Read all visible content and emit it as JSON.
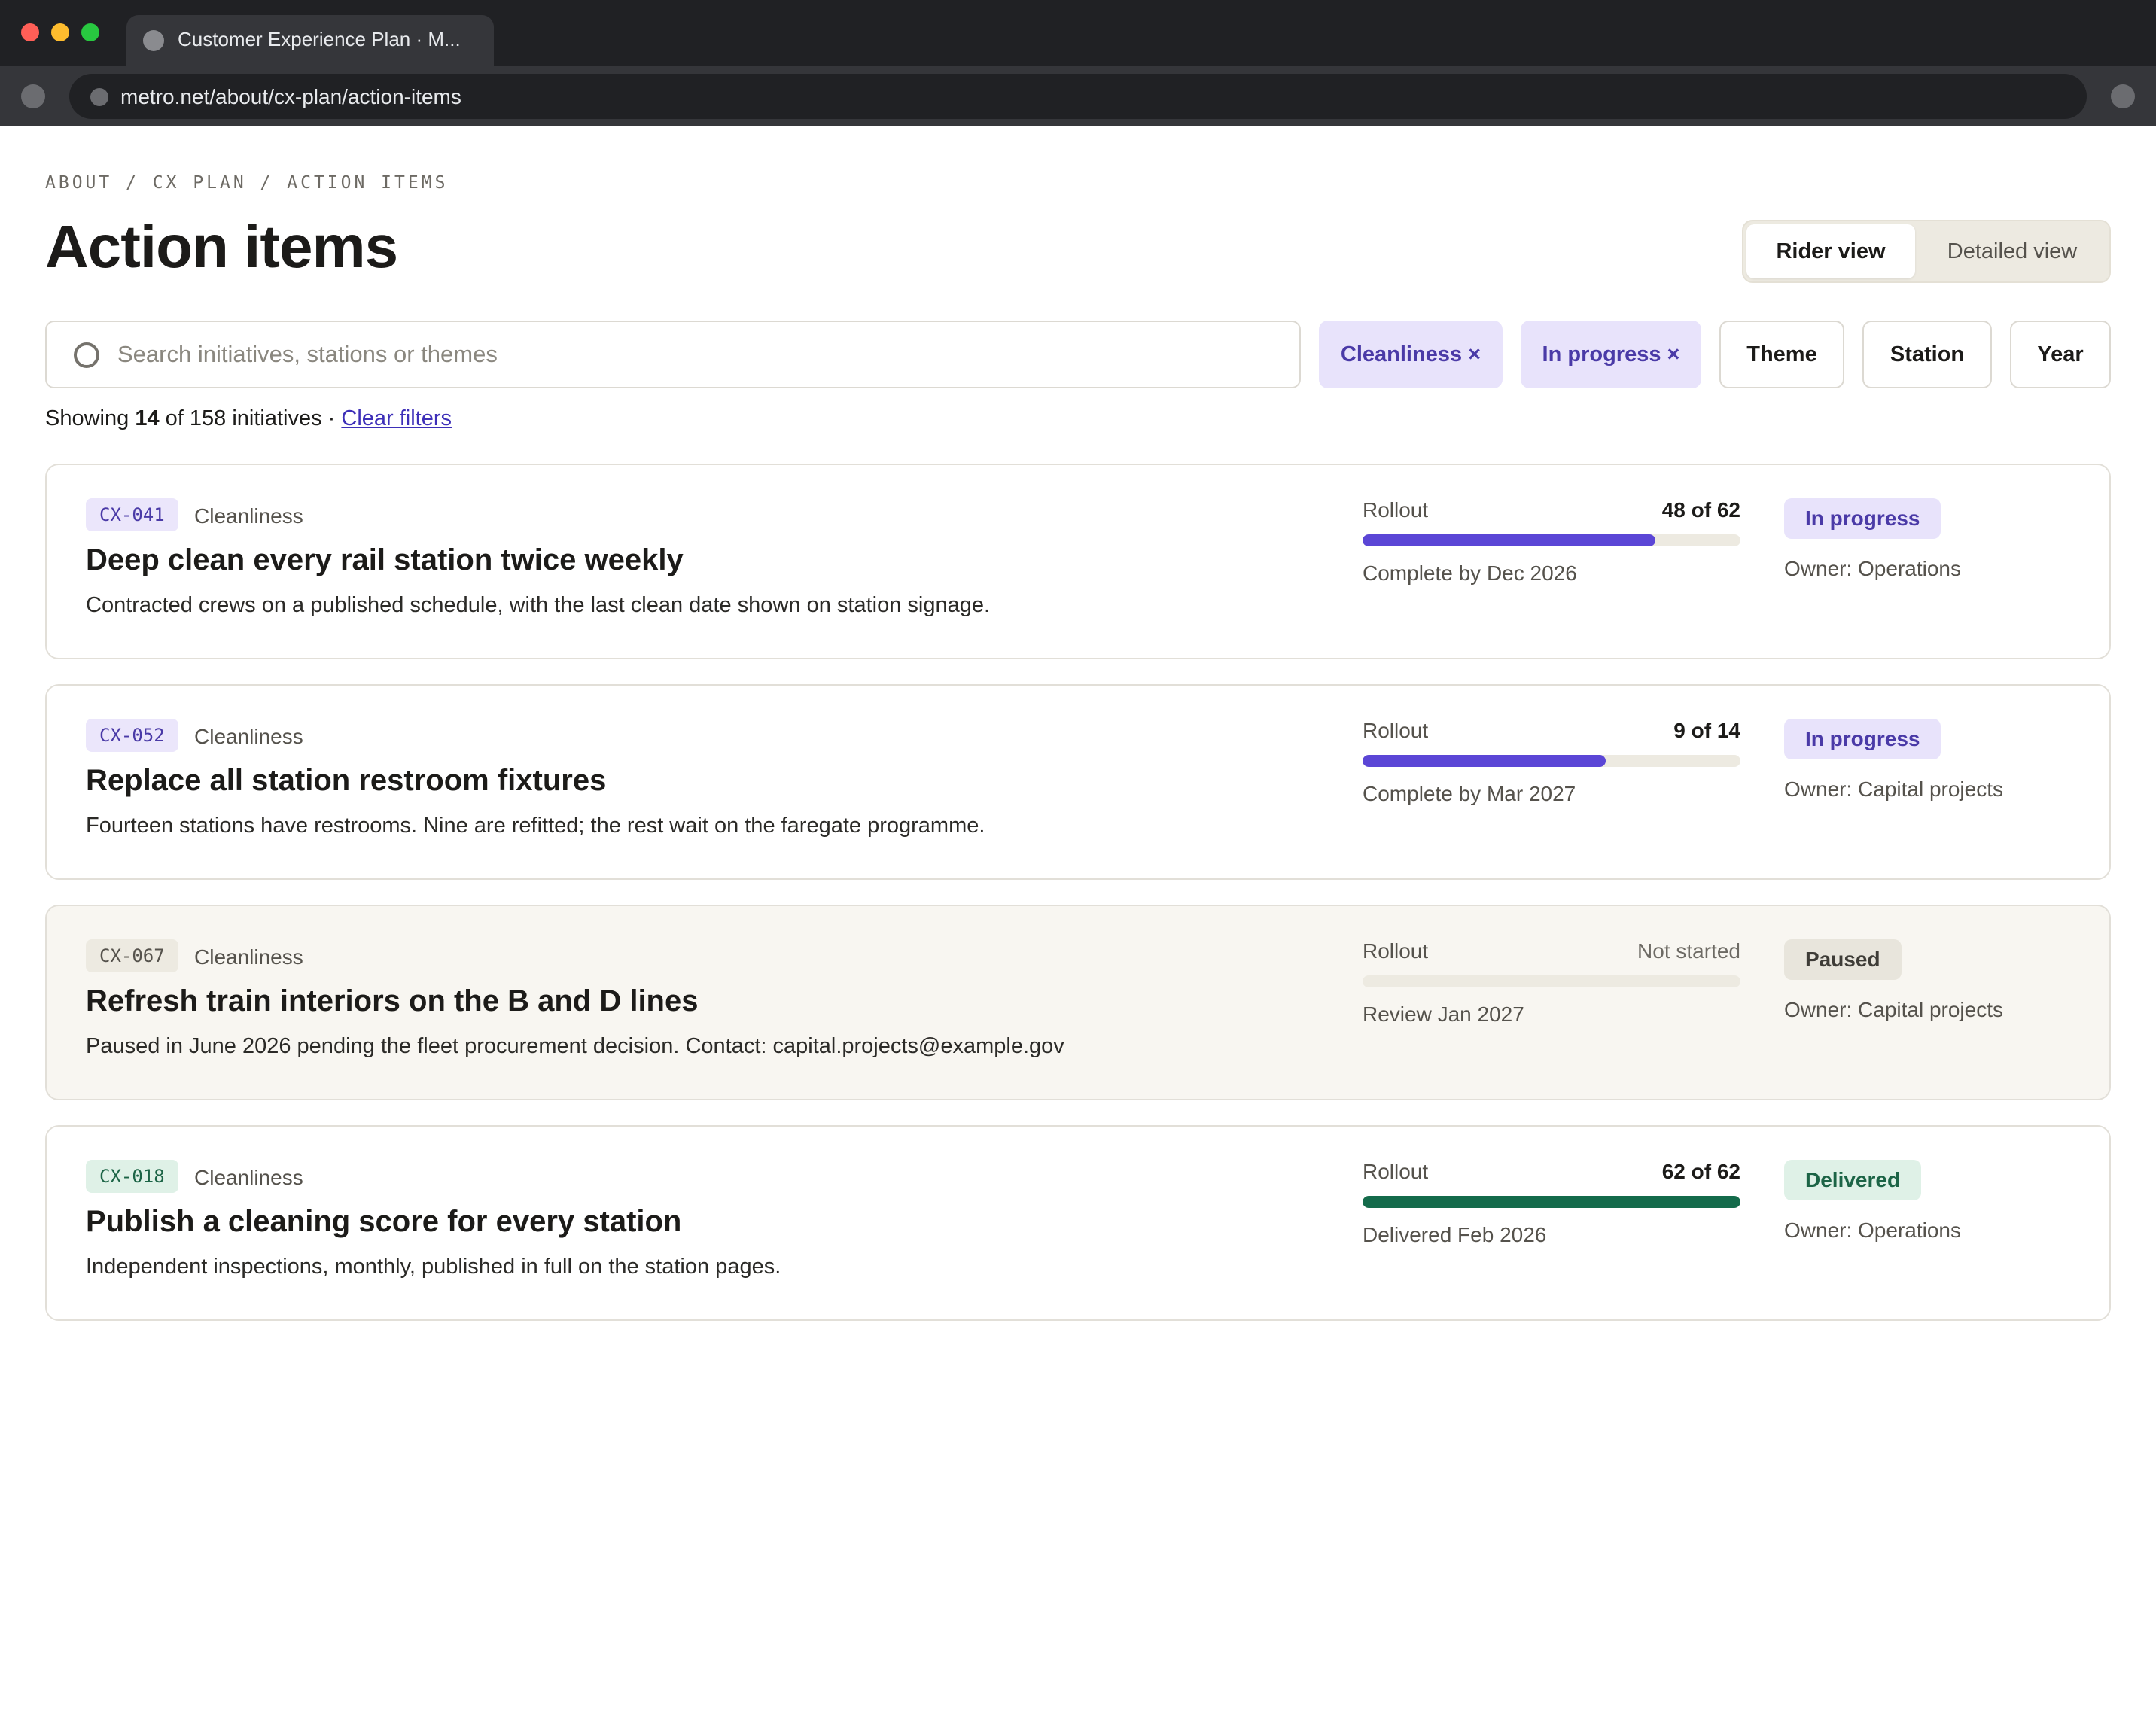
{
  "browser": {
    "tab_title": "Customer Experience Plan · M...",
    "url": "metro.net/about/cx-plan/action-items"
  },
  "breadcrumb": "ABOUT / CX PLAN / ACTION ITEMS",
  "page_title": "Action items",
  "view_toggle": {
    "active": "Rider view",
    "inactive": "Detailed view"
  },
  "search": {
    "placeholder": "Search initiatives, stations or themes",
    "value": ""
  },
  "filters": {
    "active_chips": [
      "Cleanliness ×",
      "In progress ×"
    ],
    "buttons": [
      "Theme",
      "Station",
      "Year"
    ]
  },
  "results": {
    "prefix": "Showing ",
    "shown": "14",
    "suffix": " of 158 initiatives · ",
    "clear_label": "Clear filters"
  },
  "rollout_label": "Rollout",
  "items": [
    {
      "code": "CX-041",
      "theme": "Cleanliness",
      "title": "Deep clean every rail station twice weekly",
      "description": "Contracted crews on a published schedule, with the last clean date shown on station signage.",
      "rollout_text": "48 of 62",
      "rollout_done": 48,
      "rollout_total": 62,
      "due": "Complete by Dec 2026",
      "status": "In progress",
      "owner": "Owner: Operations",
      "colors": {
        "accent": "#5b46d6",
        "status_bg": "#e8e3fb",
        "status_fg": "#4a3aa7"
      }
    },
    {
      "code": "CX-052",
      "theme": "Cleanliness",
      "title": "Replace all station restroom fixtures",
      "description": "Fourteen stations have restrooms. Nine are refitted; the rest wait on the faregate programme.",
      "rollout_text": "9 of 14",
      "rollout_done": 9,
      "rollout_total": 14,
      "due": "Complete by Mar 2027",
      "status": "In progress",
      "owner": "Owner: Capital projects",
      "colors": {
        "accent": "#5b46d6",
        "status_bg": "#e8e3fb",
        "status_fg": "#4a3aa7"
      }
    },
    {
      "code": "CX-067",
      "theme": "Cleanliness",
      "title": "Refresh train interiors on the B and D lines",
      "description": "Paused in June 2026 pending the fleet procurement decision. Contact: capital.projects@example.gov",
      "rollout_text": "Not started",
      "rollout_done": 0,
      "rollout_total": 1,
      "due": "Review Jan 2027",
      "status": "Paused",
      "owner": "Owner: Capital projects",
      "colors": {
        "accent": "#a8a49a",
        "status_bg": "#e8e5dc",
        "status_fg": "#3e3c37",
        "card_bg": "#f8f6f1"
      }
    },
    {
      "code": "CX-018",
      "theme": "Cleanliness",
      "title": "Publish a cleaning score for every station",
      "description": "Independent inspections, monthly, published in full on the station pages.",
      "rollout_text": "62 of 62",
      "rollout_done": 62,
      "rollout_total": 62,
      "due": "Delivered Feb 2026",
      "status": "Delivered",
      "owner": "Owner: Operations",
      "colors": {
        "accent": "#146b4b",
        "status_bg": "#dff1e7",
        "status_fg": "#1c6446"
      }
    }
  ]
}
